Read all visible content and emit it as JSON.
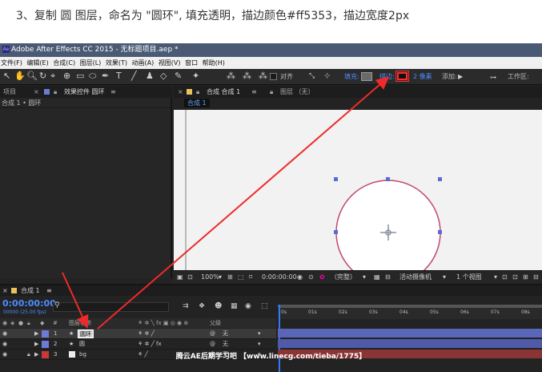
{
  "heading": {
    "text": "3、复制 圆 图层，命名为 \"圆环\", 填充透明，描边颜色#ff5353，描边宽度2px"
  },
  "window": {
    "title": "Adobe After Effects CC 2015 - 无标题项目.aep *"
  },
  "menu": [
    "文件(F)",
    "编辑(E)",
    "合成(C)",
    "图层(L)",
    "效果(T)",
    "动画(A)",
    "视图(V)",
    "窗口",
    "帮助(H)"
  ],
  "toolbar": {
    "align_label": "对齐",
    "fill_label": "填充:",
    "stroke_label": "描边:",
    "stroke_width": "2 像素",
    "add_label": "添加:",
    "workspace_label": "工作区:",
    "stroke_color": "#ff5353"
  },
  "left_panel": {
    "tab_project": "项目",
    "tab_effects": "效果控件 圆环",
    "subtitle": "合成 1 • 圆环"
  },
  "comp_panel": {
    "tab_label": "合成 合成 1",
    "layer_label": "图层 （无）",
    "sub_tab": "合成 1",
    "zoom": "100%",
    "timecode": "0:00:00:00",
    "quality": "（完整）",
    "camera": "活动摄像机",
    "views": "1 个视图"
  },
  "timeline": {
    "tab": "合成 1",
    "timecode": "0:00:00:00",
    "fps": "00000 (25.00 fps)",
    "columns": {
      "num": "#",
      "name": "图层名称",
      "parent": "父级"
    },
    "ruler": [
      "0s",
      "01s",
      "02s",
      "03s",
      "04s",
      "05s",
      "06s",
      "07s",
      "08s"
    ],
    "layers": [
      {
        "num": "1",
        "name": "圆环",
        "parent": "无",
        "color": "#6b7bd6",
        "selected": true
      },
      {
        "num": "2",
        "name": "圆",
        "parent": "无",
        "color": "#6b7bd6",
        "selected": false
      },
      {
        "num": "3",
        "name": "bg",
        "parent": "无",
        "color": "#c43a3a",
        "selected": false
      }
    ]
  },
  "watermark": "腾云AE后期学习吧 【www.linecg.com/tieba/1775】"
}
